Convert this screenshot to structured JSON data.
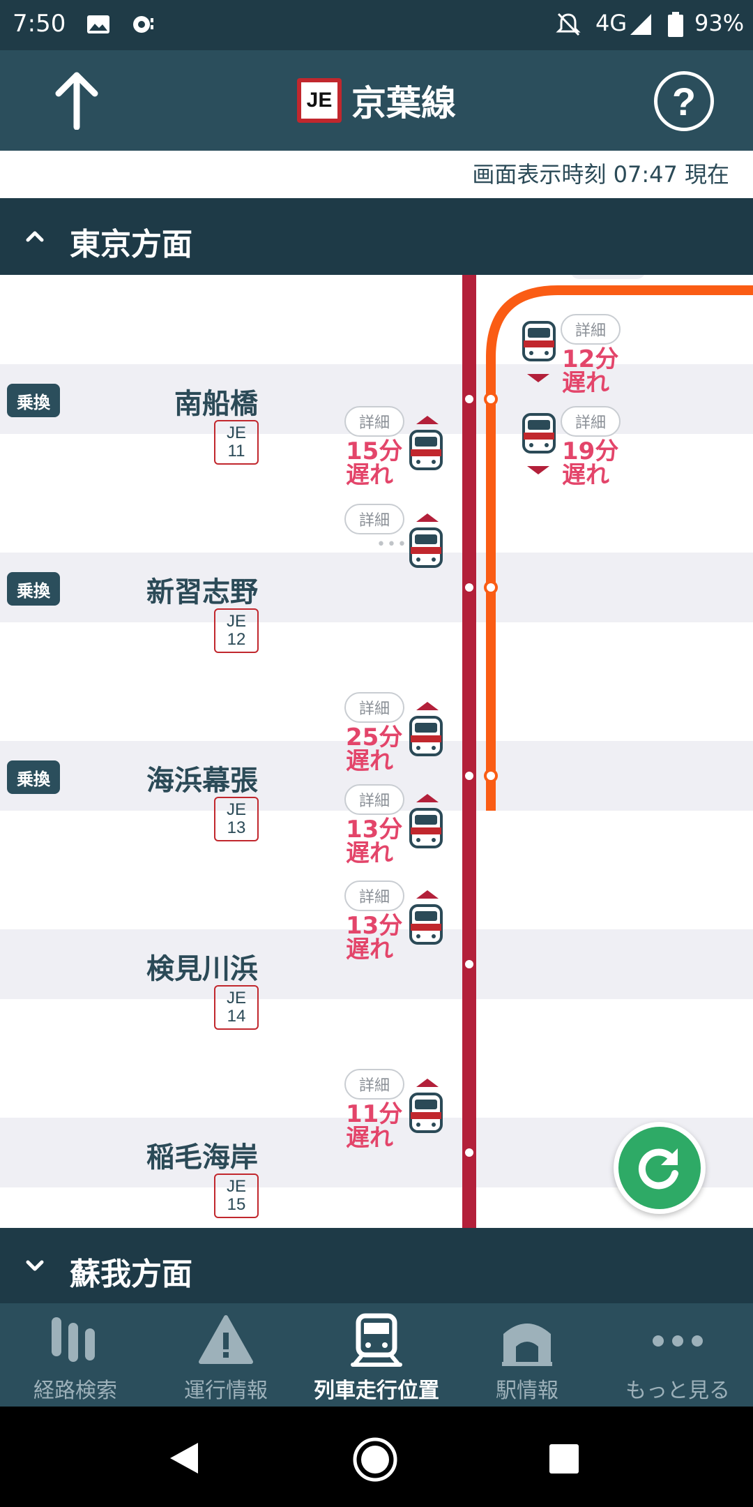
{
  "status_bar": {
    "time": "7:50",
    "network": "4G",
    "battery": "93%"
  },
  "header": {
    "line_code": "JE",
    "title": "京葉線",
    "help_label": "?"
  },
  "timestamp": "画面表示時刻 07:47 現在",
  "direction_up": {
    "label": "東京方面",
    "expanded": true
  },
  "direction_down": {
    "label": "蘇我方面",
    "expanded": false
  },
  "stations": [
    {
      "name": "南船橋",
      "code_prefix": "JE",
      "code_num": "11",
      "transfer": "乗換"
    },
    {
      "name": "新習志野",
      "code_prefix": "JE",
      "code_num": "12",
      "transfer": "乗換"
    },
    {
      "name": "海浜幕張",
      "code_prefix": "JE",
      "code_num": "13",
      "transfer": "乗換"
    },
    {
      "name": "検見川浜",
      "code_prefix": "JE",
      "code_num": "14",
      "transfer": ""
    },
    {
      "name": "稲毛海岸",
      "code_prefix": "JE",
      "code_num": "15",
      "transfer": ""
    }
  ],
  "trains_left": [
    {
      "detail": "詳細",
      "delay_min": "15分",
      "delay_word": "遅れ"
    },
    {
      "detail": "詳細",
      "delay_min": "",
      "delay_word": ""
    },
    {
      "detail": "詳細",
      "delay_min": "25分",
      "delay_word": "遅れ"
    },
    {
      "detail": "詳細",
      "delay_min": "13分",
      "delay_word": "遅れ"
    },
    {
      "detail": "詳細",
      "delay_min": "13分",
      "delay_word": "遅れ"
    },
    {
      "detail": "詳細",
      "delay_min": "11分",
      "delay_word": "遅れ"
    }
  ],
  "trains_right": [
    {
      "detail": "詳細",
      "delay_min": "12分",
      "delay_word": "遅れ"
    },
    {
      "detail": "詳細",
      "delay_min": "19分",
      "delay_word": "遅れ"
    }
  ],
  "bottom_nav": [
    {
      "label": "経路検索",
      "icon": "route-search-icon",
      "active": false
    },
    {
      "label": "運行情報",
      "icon": "warning-icon",
      "active": false
    },
    {
      "label": "列車走行位置",
      "icon": "train-icon",
      "active": true
    },
    {
      "label": "駅情報",
      "icon": "station-icon",
      "active": false
    },
    {
      "label": "もっと見る",
      "icon": "more-icon",
      "active": false
    }
  ],
  "colors": {
    "line_red": "#b3203a",
    "branch_orange": "#fa5c14",
    "header": "#2b4e5c",
    "delay": "#e3456a",
    "refresh": "#2eaa66"
  }
}
